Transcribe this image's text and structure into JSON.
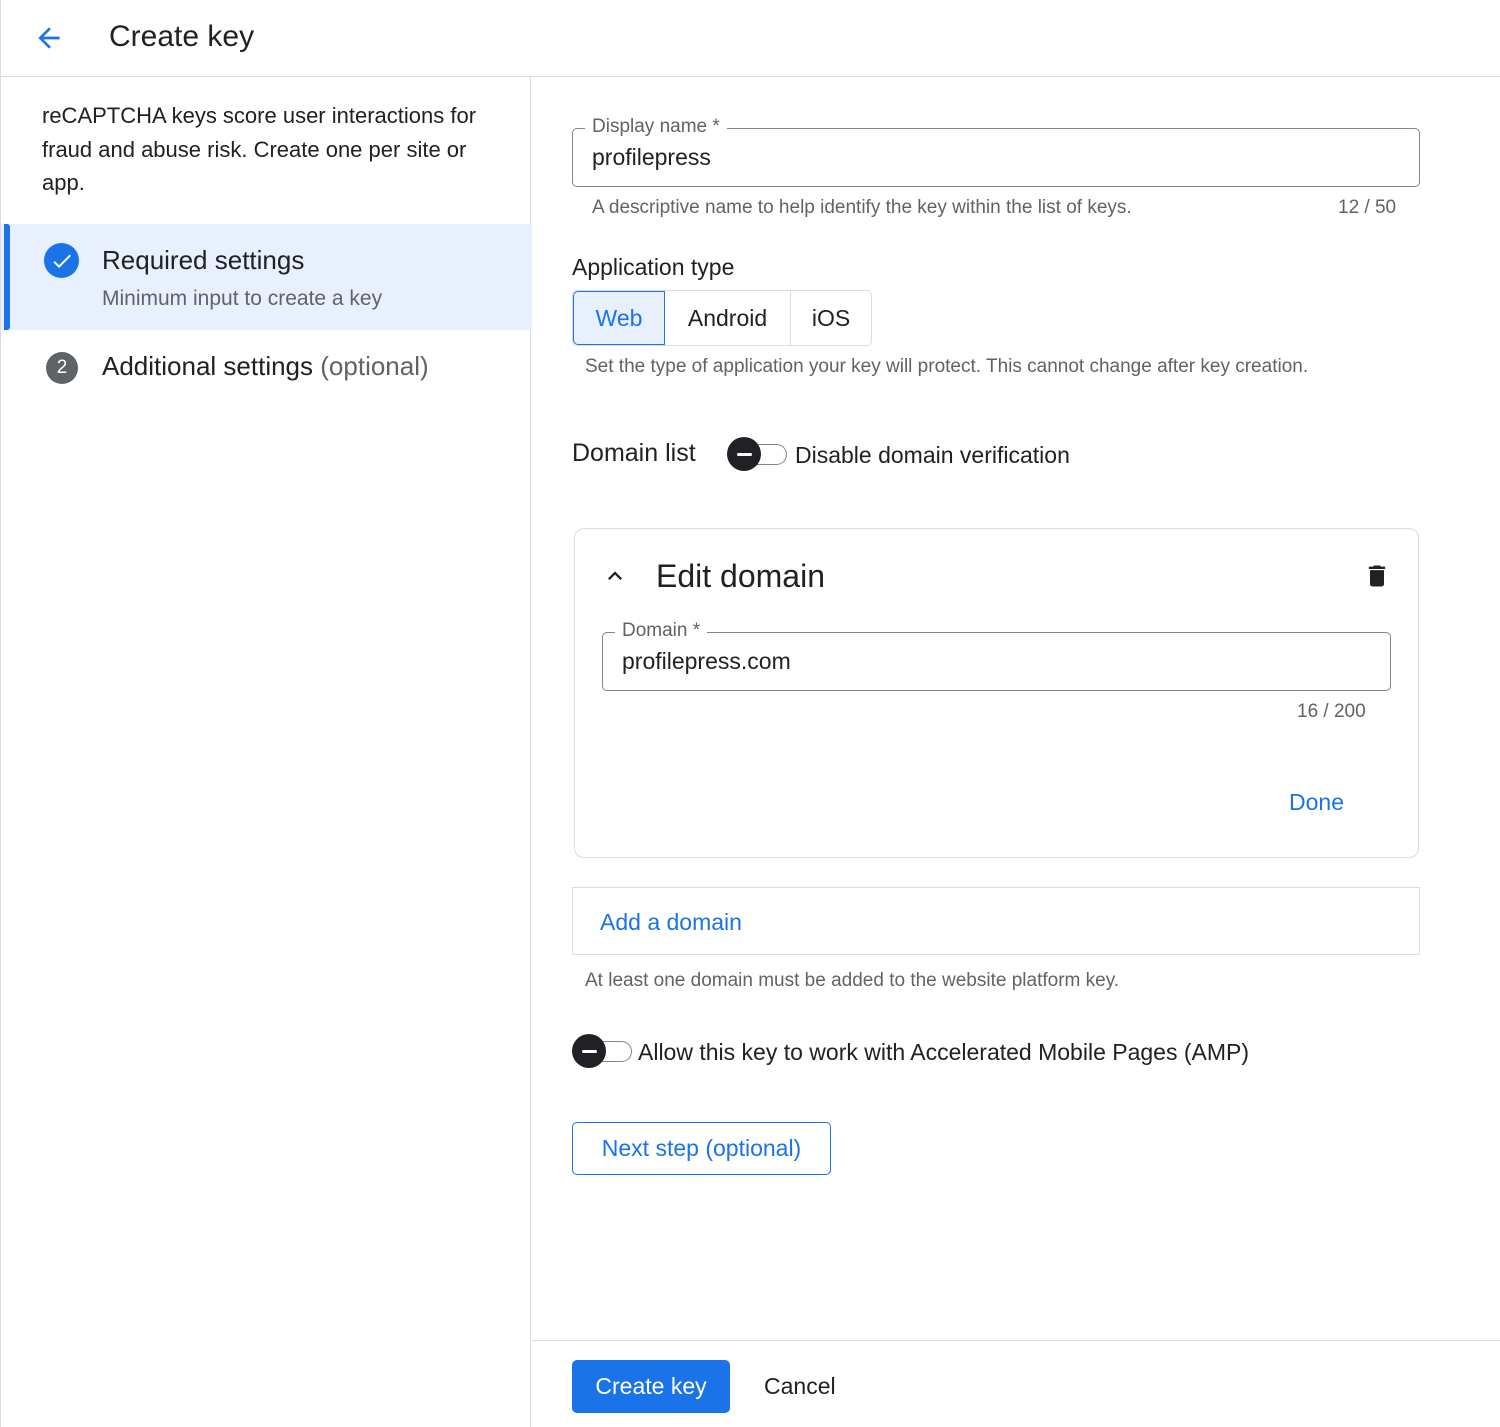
{
  "header": {
    "title": "Create key",
    "back_icon": "arrow-back-icon"
  },
  "sidebar": {
    "description": "reCAPTCHA keys score user interactions for fraud and abuse risk. Create one per site or app.",
    "steps": [
      {
        "title": "Required settings",
        "subtitle": "Minimum input to create a key",
        "status": "complete",
        "icon": "check-circle-icon"
      },
      {
        "number": "2",
        "title": "Additional settings",
        "suffix": "(optional)"
      }
    ]
  },
  "form": {
    "display_name": {
      "label": "Display name *",
      "value": "profilepress",
      "hint": "A descriptive name to help identify the key within the list of keys.",
      "counter": "12 / 50"
    },
    "application_type": {
      "title": "Application type",
      "options": [
        "Web",
        "Android",
        "iOS"
      ],
      "selected": "Web",
      "hint": "Set the type of application your key will protect. This cannot change after key creation."
    },
    "domain_list": {
      "title": "Domain list",
      "toggle_label": "Disable domain verification",
      "toggle_on": false,
      "edit_card": {
        "title": "Edit domain",
        "domain_label": "Domain *",
        "domain_value": "profilepress.com",
        "counter": "16 / 200",
        "done_label": "Done"
      },
      "add_label": "Add a domain",
      "hint": "At least one domain must be added to the website platform key."
    },
    "amp": {
      "toggle_label": "Allow this key to work with Accelerated Mobile Pages (AMP)",
      "toggle_on": false
    },
    "next_label": "Next step (optional)"
  },
  "footer": {
    "create_label": "Create key",
    "cancel_label": "Cancel"
  },
  "colors": {
    "accent": "#1a73e8",
    "accent_light": "#e8f0fe",
    "text": "#202124",
    "secondary_text": "#5f6368",
    "border": "#dadce0"
  }
}
